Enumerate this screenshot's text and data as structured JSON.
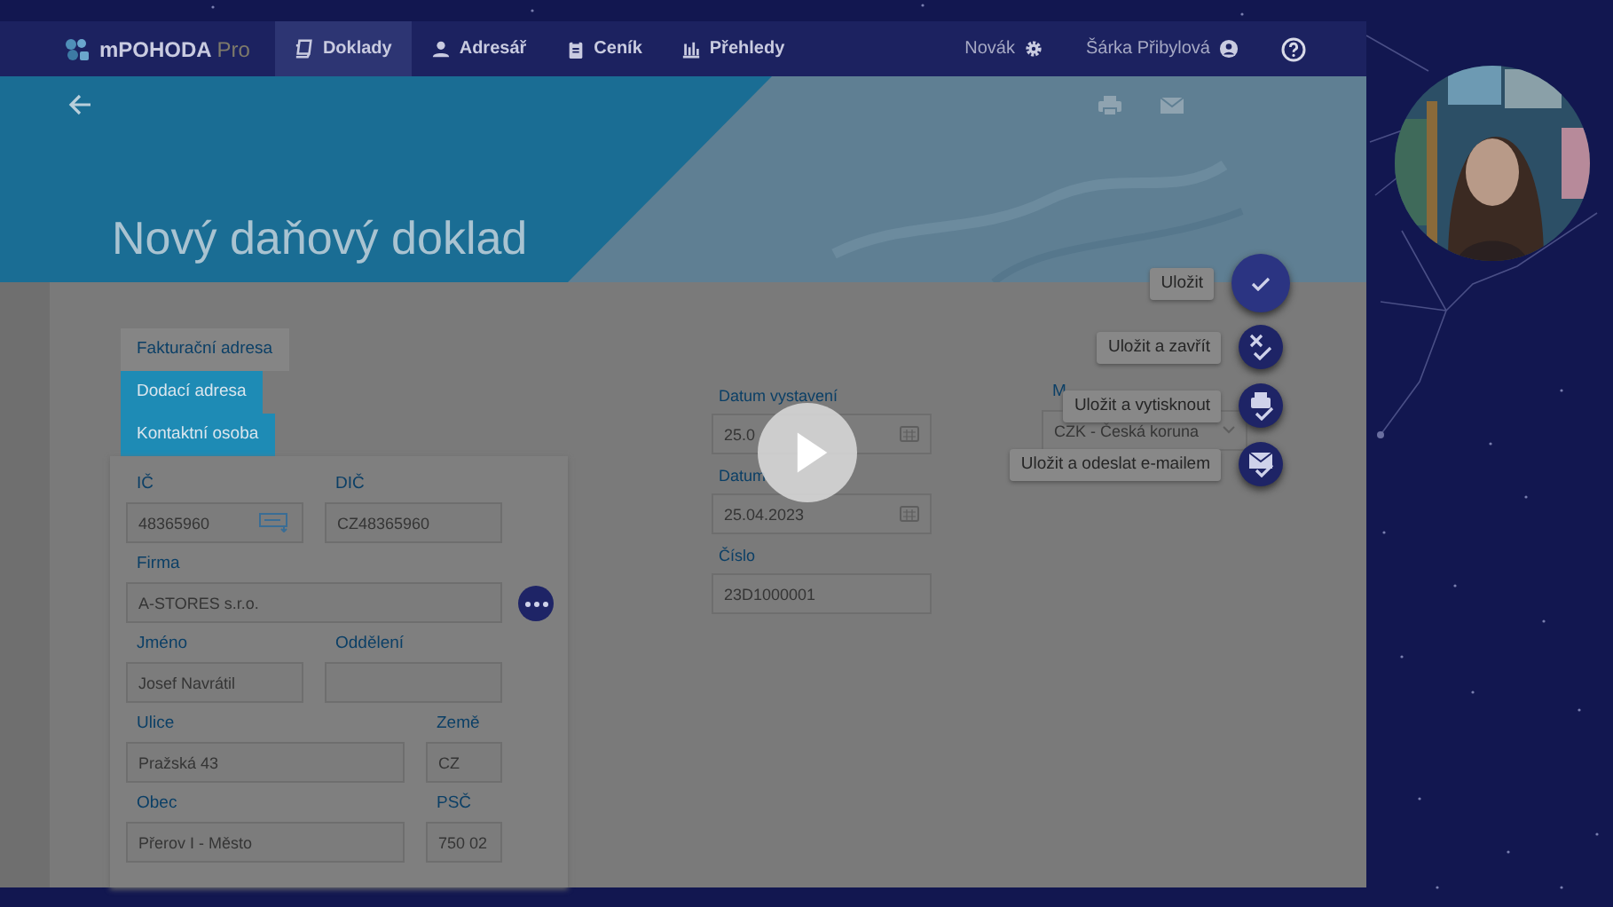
{
  "app": {
    "logo": "mPOHODA",
    "edition": "Pro",
    "nav": [
      {
        "label": "Doklady",
        "selected": true
      },
      {
        "label": "Adresář",
        "selected": false
      },
      {
        "label": "Ceník",
        "selected": false
      },
      {
        "label": "Přehledy",
        "selected": false
      }
    ],
    "user_menu": [
      {
        "label": "Novák"
      },
      {
        "label": "Šárka Přibylová"
      }
    ]
  },
  "header": {
    "title": "Nový daňový doklad"
  },
  "address_tabs": [
    {
      "label": "Fakturační adresa",
      "selected": false
    },
    {
      "label": "Dodací adresa",
      "selected": true
    },
    {
      "label": "Kontaktní osoba",
      "selected": true
    }
  ],
  "address_fields": [
    {
      "label": "IČ",
      "value": "48365960",
      "kind": "lookup"
    },
    {
      "label": "DIČ",
      "value": "CZ48365960",
      "kind": "text"
    },
    {
      "label": "Firma",
      "value": "A-STORES s.r.o.",
      "kind": "text",
      "more_button": true
    },
    {
      "label": "Jméno",
      "value": "Josef Navrátil",
      "kind": "text"
    },
    {
      "label": "Oddělení",
      "kind": "text"
    },
    {
      "label": "Ulice",
      "value": "Pražská 43",
      "kind": "text"
    },
    {
      "label": "Země",
      "value": "CZ",
      "kind": "text"
    },
    {
      "label": "Obec",
      "value": "Přerov I - Město",
      "kind": "text"
    },
    {
      "label": "PSČ",
      "value": "750 02",
      "kind": "text"
    }
  ],
  "document_fields": [
    {
      "label": "Datum vystavení",
      "value": "25.0",
      "kind": "date"
    },
    {
      "label": "Datum",
      "value": "25.04.2023",
      "kind": "date"
    },
    {
      "label": "Číslo",
      "value": "23D1000001",
      "kind": "text"
    }
  ],
  "currency": {
    "label": "M",
    "value": "CZK - Česká koruna"
  },
  "save_actions": [
    {
      "label": "Uložit",
      "kind": "main"
    },
    {
      "label": "Uložit a zavřít",
      "kind": "mini"
    },
    {
      "label": "Uložit a vytisknout",
      "kind": "mini"
    },
    {
      "label": "Uložit a odeslat e-mailem",
      "kind": "mini"
    }
  ]
}
